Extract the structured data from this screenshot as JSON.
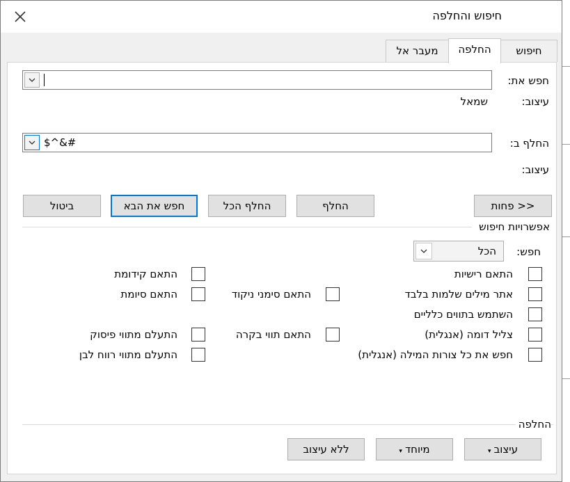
{
  "window": {
    "title": "חיפוש והחלפה"
  },
  "tabs": [
    {
      "label": "חיפוש"
    },
    {
      "label": "החלפה"
    },
    {
      "label": "מעבר אל"
    }
  ],
  "find": {
    "label": "חפש את:",
    "value": "",
    "format_label": "עיצוב:",
    "format_value": "שמאל"
  },
  "replace": {
    "label": "החלף ב:",
    "value": "$^&#",
    "format_label": "עיצוב:"
  },
  "buttons": {
    "less": "<< פחות",
    "replace": "החלף",
    "replace_all": "החלף הכל",
    "find_next": "חפש את הבא",
    "cancel": "ביטול"
  },
  "search_options": {
    "title": "אפשרויות חיפוש",
    "search_label": "חפש:",
    "search_value": "הכל",
    "right_column": [
      "התאם רישיות",
      "אתר מילים שלמות בלבד",
      "השתמש בתווים כלליים",
      "צליל דומה (אנגלית)",
      "חפש את כל צורות המילה (אנגלית)"
    ],
    "middle_column": [
      "התאם סימני ניקוד",
      "התאם תווי בקרה"
    ],
    "left_column": [
      "התאם קידומת",
      "התאם סיומת",
      "התעלם מתווי פיסוק",
      "התעלם מתווי רווח לבן"
    ]
  },
  "replace_section": {
    "title": "החלפה",
    "format_button": "עיצוב",
    "special_button": "מיוחד",
    "no_format_button": "ללא עיצוב"
  }
}
